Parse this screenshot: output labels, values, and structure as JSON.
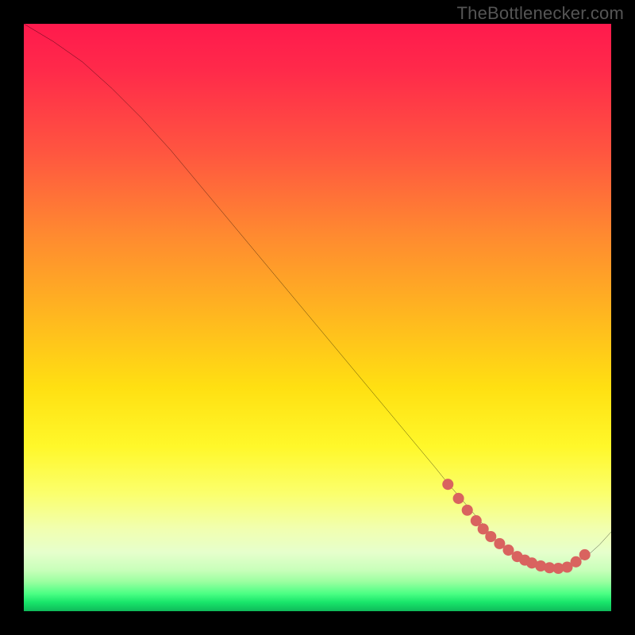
{
  "watermark": "TheBottlenecker.com",
  "chart_data": {
    "type": "line",
    "title": "",
    "xlabel": "",
    "ylabel": "",
    "xlim": [
      0,
      100
    ],
    "ylim": [
      0,
      100
    ],
    "series": [
      {
        "name": "curve",
        "x": [
          0,
          5,
          10,
          15,
          20,
          25,
          30,
          35,
          40,
          45,
          50,
          55,
          60,
          65,
          70,
          72,
          75,
          78,
          80,
          82,
          84,
          86,
          88,
          90,
          92,
          94,
          96,
          98,
          100
        ],
        "y": [
          100,
          97,
          93.5,
          89,
          84,
          78.5,
          72.5,
          66.5,
          60.5,
          54.5,
          48.5,
          42.5,
          36.5,
          30.5,
          24.5,
          22,
          18.5,
          15,
          12.5,
          10.5,
          9,
          8,
          7.4,
          7.2,
          7.4,
          8.2,
          9.5,
          11.3,
          13.5
        ]
      }
    ],
    "markers": {
      "name": "highlight-dots",
      "color": "#d9635f",
      "points_x": [
        72.2,
        74,
        75.5,
        77,
        78.2,
        79.5,
        81,
        82.5,
        84,
        85.3,
        86.5,
        88,
        89.5,
        91,
        92.5,
        94,
        95.5
      ],
      "points_y": [
        21.6,
        19.2,
        17.2,
        15.4,
        14,
        12.7,
        11.5,
        10.4,
        9.3,
        8.7,
        8.2,
        7.7,
        7.4,
        7.3,
        7.5,
        8.4,
        9.6
      ]
    },
    "gradient_stops": [
      {
        "pos": 0,
        "color": "#ff1a4d"
      },
      {
        "pos": 0.32,
        "color": "#ff8a30"
      },
      {
        "pos": 0.6,
        "color": "#ffe012"
      },
      {
        "pos": 0.82,
        "color": "#f5ff88"
      },
      {
        "pos": 0.93,
        "color": "#c8ffba"
      },
      {
        "pos": 0.97,
        "color": "#4cff84"
      },
      {
        "pos": 1.0,
        "color": "#0fb95a"
      }
    ]
  }
}
